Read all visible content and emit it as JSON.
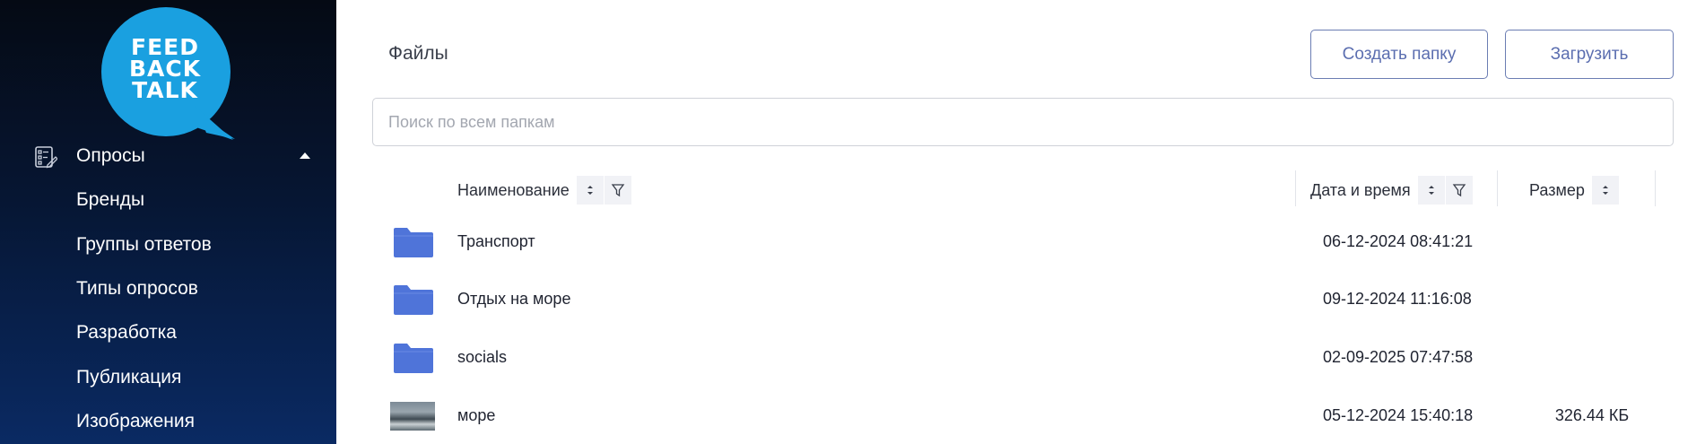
{
  "sidebar": {
    "logo_lines": [
      "FEED",
      "BACK",
      "TALK"
    ],
    "menu": [
      {
        "label": "Опросы",
        "icon": "survey-list-icon",
        "expanded": true
      },
      {
        "label": "Бренды"
      },
      {
        "label": "Группы ответов"
      },
      {
        "label": "Типы опросов"
      },
      {
        "label": "Разработка"
      },
      {
        "label": "Публикация"
      },
      {
        "label": "Изображения"
      }
    ]
  },
  "main": {
    "title": "Файлы",
    "buttons": {
      "create_folder": "Создать папку",
      "upload": "Загрузить"
    },
    "search": {
      "placeholder": "Поиск по всем папкам",
      "value": ""
    },
    "columns": {
      "name": "Наименование",
      "date": "Дата и время",
      "size": "Размер"
    },
    "rows": [
      {
        "type": "folder",
        "name": "Транспорт",
        "date": "06-12-2024 08:41:21",
        "size": ""
      },
      {
        "type": "folder",
        "name": "Отдых на море",
        "date": "09-12-2024 11:16:08",
        "size": ""
      },
      {
        "type": "folder",
        "name": "socials",
        "date": "02-09-2025 07:47:58",
        "size": ""
      },
      {
        "type": "image",
        "name": "море",
        "date": "05-12-2024 15:40:18",
        "size": "326.44 КБ"
      }
    ]
  },
  "colors": {
    "accent": "#5b6eb0",
    "folder": "#4f74d9",
    "logo_blue": "#1aa0e0",
    "sidebar_top": "#050a14",
    "sidebar_bottom": "#0a2a63"
  }
}
